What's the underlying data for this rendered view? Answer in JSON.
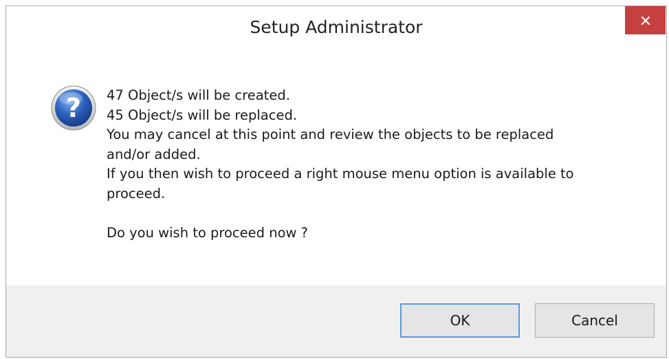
{
  "window": {
    "title": "Setup Administrator"
  },
  "dialog": {
    "icon": "question-icon",
    "message_lines": [
      "47 Object/s will be created.",
      "45 Object/s will be replaced.",
      "You may cancel at this point and review the objects to be replaced",
      "and/or added.",
      "If you then wish to proceed a right mouse menu option is available to",
      "proceed.",
      "",
      "Do you wish to proceed now ?"
    ]
  },
  "buttons": {
    "ok_label": "OK",
    "cancel_label": "Cancel"
  },
  "colors": {
    "close_button": "#c74040",
    "footer_background": "#f0f0f0",
    "focus_border": "#5c9ad8",
    "icon_blue": "#2a5fb8"
  }
}
